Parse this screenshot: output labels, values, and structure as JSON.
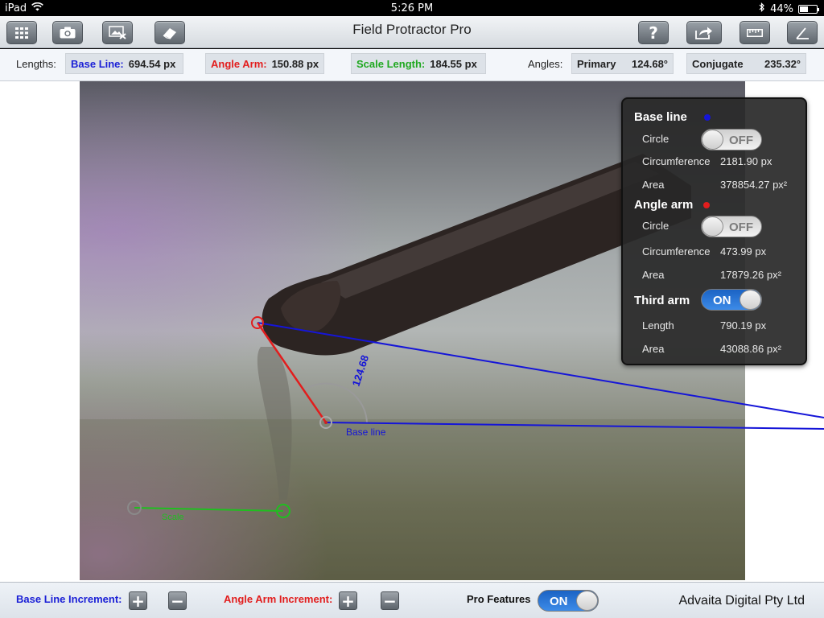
{
  "status_bar": {
    "device": "iPad",
    "time": "5:26 PM",
    "battery": "44%",
    "battery_level": 0.44
  },
  "toolbar": {
    "title": "Field Protractor Pro",
    "left_buttons": [
      {
        "icon": "grid-icon"
      },
      {
        "icon": "camera-icon"
      },
      {
        "icon": "clear-image-icon"
      },
      {
        "icon": "eraser-icon"
      }
    ],
    "right_buttons": [
      {
        "icon": "help-icon",
        "label": "?"
      },
      {
        "icon": "share-icon"
      },
      {
        "icon": "ruler-icon"
      },
      {
        "icon": "angle-icon"
      }
    ]
  },
  "info_bar": {
    "lengths_label": "Lengths:",
    "base_line_key": "Base Line:",
    "base_line_value": "694.54 px",
    "angle_arm_key": "Angle Arm:",
    "angle_arm_value": "150.88 px",
    "scale_length_key": "Scale Length:",
    "scale_length_value": "184.55 px",
    "angles_label": "Angles:",
    "primary_key": "Primary",
    "primary_value": "124.68°",
    "conjugate_key": "Conjugate",
    "conjugate_value": "235.32°"
  },
  "canvas": {
    "angle_label": "124.68",
    "base_line_label": "Base line",
    "scale_label": "Scale",
    "colors": {
      "base_line": "#1515d8",
      "angle_arm": "#e21d1d",
      "scale": "#1fbf1f"
    }
  },
  "panel": {
    "base_line": {
      "title": "Base line",
      "circle_label": "Circle",
      "circle_toggle": "OFF",
      "circumference_label": "Circumference",
      "circumference_value": "2181.90 px",
      "area_label": "Area",
      "area_value": "378854.27 px²"
    },
    "angle_arm": {
      "title": "Angle arm",
      "circle_label": "Circle",
      "circle_toggle": "OFF",
      "circumference_label": "Circumference",
      "circumference_value": "473.99 px",
      "area_label": "Area",
      "area_value": "17879.26 px²"
    },
    "third_arm": {
      "title": "Third arm",
      "toggle": "ON",
      "length_label": "Length",
      "length_value": "790.19 px",
      "area_label": "Area",
      "area_value": "43088.86 px²"
    }
  },
  "bottom_bar": {
    "base_line_increment_label": "Base Line Increment:",
    "angle_arm_increment_label": "Angle Arm Increment:",
    "plus_label": "+",
    "minus_label": "−",
    "pro_features_label": "Pro Features",
    "pro_features_toggle": "ON",
    "company": "Advaita Digital Pty Ltd"
  }
}
